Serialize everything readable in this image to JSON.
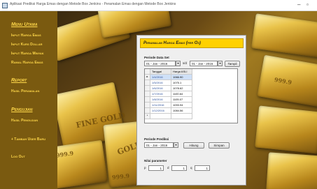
{
  "window": {
    "title": "Aplikasi Prediksi Harga Emas dengan Metode Box Jenkins - Peramalan Emas dengan Metode Box Jenkins"
  },
  "sidebar": {
    "menu_utama": "Menu Utama",
    "items_main": [
      "Input Harga Emas",
      "Input Kurs Dollar",
      "Input Harga Minyak",
      "Ramal Harga Emas"
    ],
    "report_head": "Report",
    "report_items": [
      "Hasil Peramalan"
    ],
    "pengujian_head": "Pengujian",
    "pengujian_items": [
      "Hasil Pengujian"
    ],
    "tambah_user": "+ Tambah User Baru",
    "logout": "Log Out"
  },
  "background": {
    "stamps": [
      "FINE GOLD",
      "999.9",
      "999.9",
      "GOLD",
      "999.9"
    ]
  },
  "panel": {
    "title": "Peramalan Harga Emas (per Oz)",
    "periode_data_set_label": "Periode Data Set",
    "date_from": "01 - Jan - 2016",
    "to_label": "s/d",
    "date_to": "01 - Jan - 2016",
    "tampil_label": "Tampil",
    "table": {
      "headers": [
        "Tanggal",
        "Harga ASLI"
      ],
      "rows": [
        {
          "date": "1/4/2016",
          "value": "1066.90"
        },
        {
          "date": "1/5/2016",
          "value": "1075.1"
        },
        {
          "date": "1/6/2016",
          "value": "1078.62"
        },
        {
          "date": "1/7/2016",
          "value": "1100.64"
        },
        {
          "date": "1/8/2016",
          "value": "1105.07"
        },
        {
          "date": "1/11/2016",
          "value": "1093.94"
        },
        {
          "date": "1/12/2016",
          "value": "1084.56"
        }
      ],
      "new_row_marker": "*"
    },
    "periode_prediksi_label": "Periode Prediksi",
    "prediksi_date": "01 - Jan - 2016",
    "hitung_label": "Hitung",
    "simpan_label": "Simpan",
    "nilai_parameter_label": "Nilai parameter",
    "p_label": "p",
    "p_value": "1",
    "d_label": "d",
    "d_value": "1",
    "q_label": "q",
    "q_value": "1"
  }
}
